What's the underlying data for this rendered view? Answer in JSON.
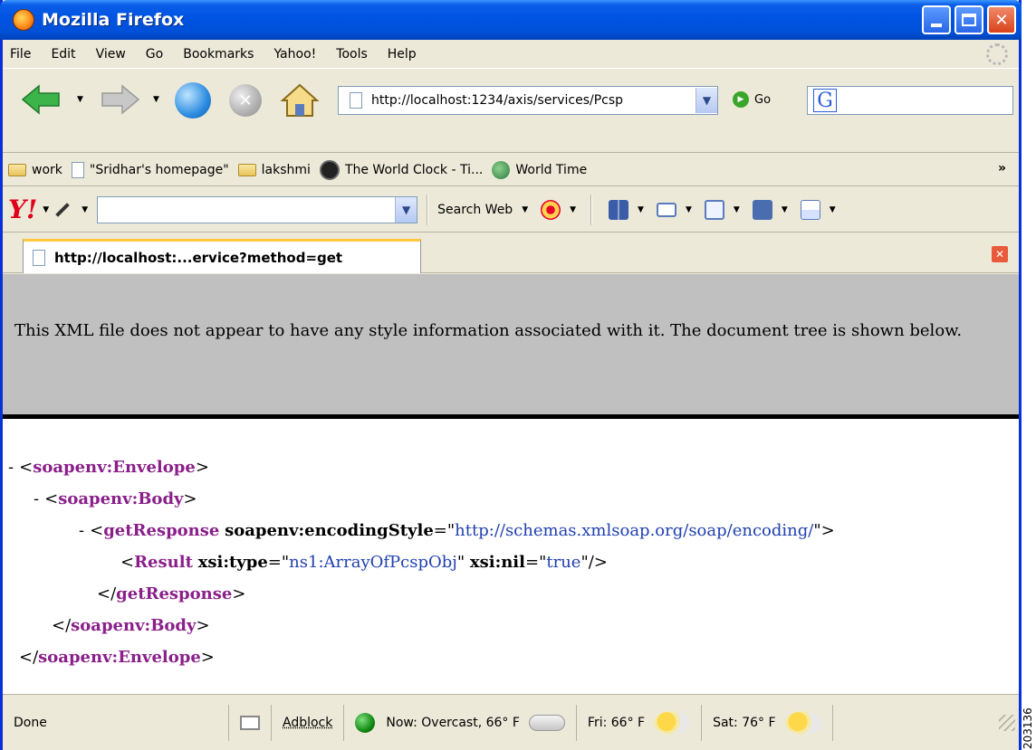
{
  "window": {
    "title": "Mozilla Firefox"
  },
  "menu": [
    "File",
    "Edit",
    "View",
    "Go",
    "Bookmarks",
    "Yahoo!",
    "Tools",
    "Help"
  ],
  "nav": {
    "url": "http://localhost:1234/axis/services/Pcsp",
    "go_label": "Go",
    "search_brand": "G"
  },
  "bookmarks": {
    "items": [
      {
        "label": "work",
        "icon": "folder-icon"
      },
      {
        "label": "\"Sridhar's homepage\"",
        "icon": "page-icon"
      },
      {
        "label": "lakshmi",
        "icon": "folder-icon"
      },
      {
        "label": "The World Clock - Ti...",
        "icon": "clock-icon"
      },
      {
        "label": "World Time",
        "icon": "globe-icon"
      }
    ],
    "more": "»"
  },
  "yahoo": {
    "logo": "Y!",
    "search_web_label": "Search Web"
  },
  "tab": {
    "label": "http://localhost:...ervice?method=get"
  },
  "xml": {
    "notice": "This XML file does not appear to have any style information associated with it. The document tree is shown below.",
    "envelope_tag": "soapenv:Envelope",
    "body_tag": "soapenv:Body",
    "getresponse_tag": "getResponse",
    "encoding_attr": "soapenv:encodingStyle",
    "encoding_val": "http://schemas.xmlsoap.org/soap/encoding/",
    "result_tag": "Result",
    "type_attr": "xsi:type",
    "type_val": "ns1:ArrayOfPcspObj",
    "nil_attr": "xsi:nil",
    "nil_val": "true"
  },
  "status": {
    "text": "Done",
    "adblock": "Adblock",
    "weather_now": "Now: Overcast, 66° F",
    "weather_fri": "Fri: 66° F",
    "weather_sat": "Sat: 76° F"
  },
  "figure_id": "203136"
}
